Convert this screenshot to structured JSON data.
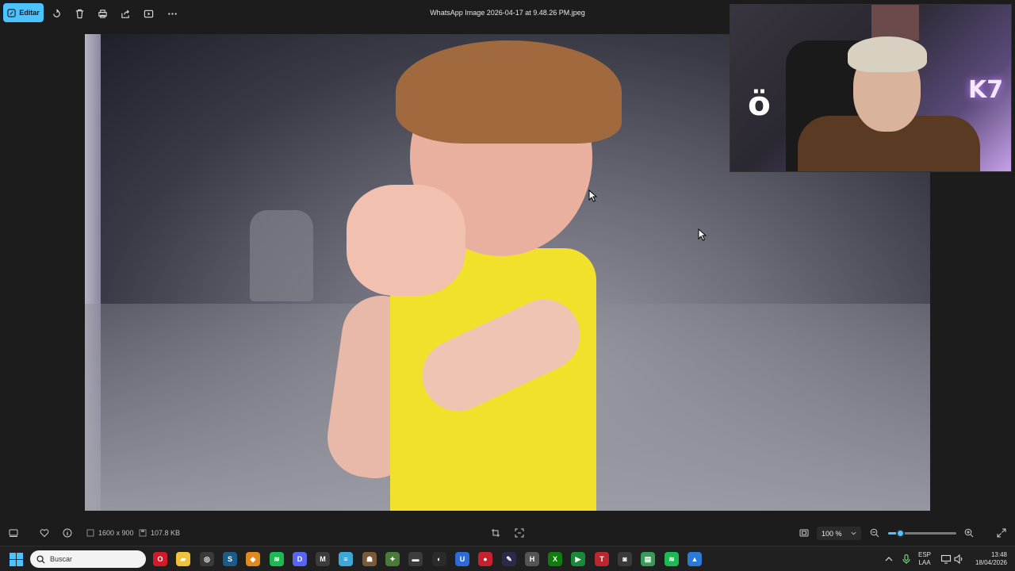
{
  "toolbar": {
    "edit_label": "Editar",
    "file_title": "WhatsApp Image 2026-04-17 at 9.48.26 PM.jpeg",
    "icons": [
      "edit-icon",
      "rotate-icon",
      "delete-icon",
      "print-icon",
      "share-icon",
      "slideshow-icon",
      "more-icon"
    ]
  },
  "image": {
    "description_icon": "photo"
  },
  "statusbar": {
    "dimensions": "1600 x 900",
    "file_size": "107.8 KB",
    "zoom": "100 %",
    "zoom_level": 0.18
  },
  "taskbar": {
    "search_placeholder": "Buscar",
    "language_top": "ESP",
    "language_bottom": "LAA",
    "time": "13:48",
    "date": "18/04/2026",
    "apps": [
      {
        "name": "opera-icon",
        "color": "#d01b2a",
        "glyph": "O"
      },
      {
        "name": "file-explorer-icon",
        "color": "#f0c23a",
        "glyph": "▰"
      },
      {
        "name": "chrome-icon",
        "color": "#3a3a3a",
        "glyph": "◎"
      },
      {
        "name": "steam-icon",
        "color": "#1b5c8a",
        "glyph": "S"
      },
      {
        "name": "shield-app-icon",
        "color": "#e08a1e",
        "glyph": "◆"
      },
      {
        "name": "spotify-icon",
        "color": "#1db954",
        "glyph": "≋"
      },
      {
        "name": "discord-icon",
        "color": "#5865f2",
        "glyph": "D"
      },
      {
        "name": "app-cm-icon",
        "color": "#3c3c3c",
        "glyph": "M"
      },
      {
        "name": "notepad-icon",
        "color": "#3fa6d8",
        "glyph": "≡"
      },
      {
        "name": "game-icon",
        "color": "#7a5a3a",
        "glyph": "☗"
      },
      {
        "name": "game2-icon",
        "color": "#4a7a3a",
        "glyph": "✦"
      },
      {
        "name": "car-app-icon",
        "color": "#3c3c3c",
        "glyph": "▬"
      },
      {
        "name": "obs-icon",
        "color": "#2b2b2b",
        "glyph": "◐"
      },
      {
        "name": "vpn-icon",
        "color": "#2e6bd6",
        "glyph": "U"
      },
      {
        "name": "red-app-icon",
        "color": "#c8202e",
        "glyph": "●"
      },
      {
        "name": "tool-app-icon",
        "color": "#2a2a4a",
        "glyph": "✎"
      },
      {
        "name": "app-h-icon",
        "color": "#555",
        "glyph": "H"
      },
      {
        "name": "xbox-icon",
        "color": "#107c10",
        "glyph": "X"
      },
      {
        "name": "xbox-app-icon",
        "color": "#1a8a3a",
        "glyph": "▶"
      },
      {
        "name": "twitter-tool-icon",
        "color": "#b8282e",
        "glyph": "T"
      },
      {
        "name": "media-app-icon",
        "color": "#3a3a3a",
        "glyph": "◙"
      },
      {
        "name": "stack-app-icon",
        "color": "#3a9a5a",
        "glyph": "▤"
      },
      {
        "name": "spotify2-icon",
        "color": "#1db954",
        "glyph": "≋"
      },
      {
        "name": "photos-icon",
        "color": "#2a7ad6",
        "glyph": "▲"
      }
    ]
  }
}
